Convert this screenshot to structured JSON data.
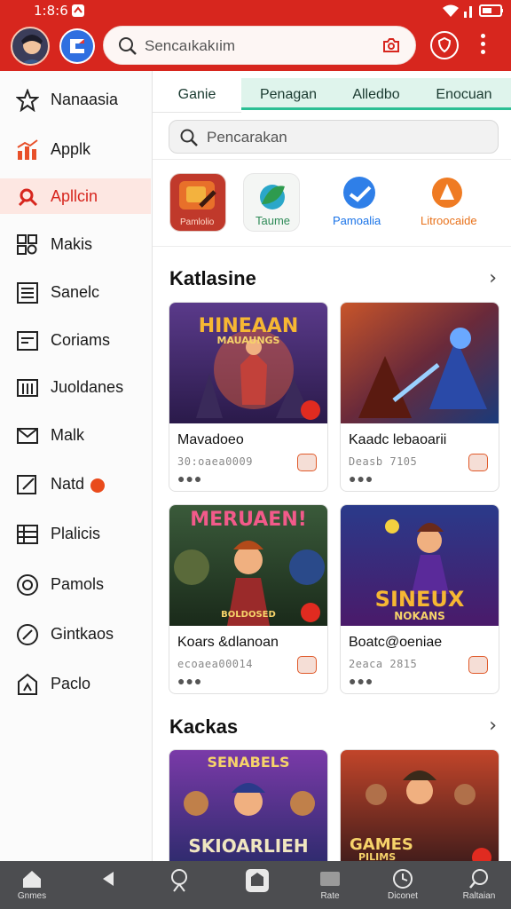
{
  "status_bar": {
    "time": "1:8:6 6"
  },
  "top_bar": {
    "search_placeholder": "Sencaıkakıim",
    "icons": [
      "avatar",
      "app-logo-icon",
      "search-icon",
      "camera-icon",
      "shield-icon",
      "more-vert-icon"
    ]
  },
  "sidebar": {
    "items": [
      {
        "label": "Nanaasia",
        "icon": "star-icon",
        "active": false
      },
      {
        "label": "Applk",
        "icon": "chart-icon",
        "active": false
      },
      {
        "label": "Apllcin",
        "icon": "rocket-icon",
        "active": true
      },
      {
        "label": "Makis",
        "icon": "grid-icon",
        "active": false
      },
      {
        "label": "Sanelc",
        "icon": "list-icon",
        "active": false
      },
      {
        "label": "Coriams",
        "icon": "monitor-icon",
        "active": false
      },
      {
        "label": "Juoldanes",
        "icon": "bars-icon",
        "active": false
      },
      {
        "label": "Malk",
        "icon": "mail-icon",
        "active": false
      },
      {
        "label": "Natd",
        "icon": "edit-icon",
        "active": false,
        "badge": true
      },
      {
        "label": "Plalicis",
        "icon": "table-icon",
        "active": false
      },
      {
        "label": "Pamols",
        "icon": "globe-icon",
        "active": false
      },
      {
        "label": "Gintkaos",
        "icon": "leaf-icon",
        "active": false
      },
      {
        "label": "Paclo",
        "icon": "bag-icon",
        "active": false
      }
    ]
  },
  "content": {
    "tabs": [
      "Ganie",
      "Penagan",
      "Alledbo",
      "Enocuan"
    ],
    "search_placeholder": "Pencarakan",
    "shortcuts": [
      {
        "label": "Pamlolio",
        "color": "#c0392b"
      },
      {
        "label": "Taume",
        "color": "#2e8b57"
      },
      {
        "label": "Pamoalia",
        "color": "#1a73e8"
      },
      {
        "label": "Litroocaide",
        "color": "#e8711a"
      }
    ],
    "section1": {
      "title": "Katlasine",
      "cards": [
        {
          "art_text": "HINEAAN",
          "art_sub": "MAUAUNGS",
          "title": "Mavadoeo",
          "sub": "30:oaea0009"
        },
        {
          "art_text": "",
          "art_sub": "",
          "title": "Kaadc lebaoarii",
          "sub": "Deasb 7105"
        },
        {
          "art_text": "MERUAEN!",
          "art_sub": "BOLDOSED",
          "title": "Koars &dlanoan",
          "sub": "ecoaea00014"
        },
        {
          "art_text": "SINEUX",
          "art_sub": "NOKANS",
          "title": "Boatc@oeniae",
          "sub": "2eaca 2815"
        }
      ]
    },
    "section2": {
      "title": "Kackas",
      "cards": [
        {
          "art_text": "SENABELS",
          "art_sub": "SKIOARLIEH"
        },
        {
          "art_text": "GAMES",
          "art_sub": "PILIMS"
        }
      ]
    }
  },
  "bottom_nav": [
    {
      "label": "Gnmes",
      "icon": "home-icon"
    },
    {
      "label": "",
      "icon": "back-icon"
    },
    {
      "label": "",
      "icon": "location-icon"
    },
    {
      "label": "",
      "icon": "cube-icon"
    },
    {
      "label": "Rate",
      "icon": "card-icon"
    },
    {
      "label": "Diconet",
      "icon": "clock-icon"
    },
    {
      "label": "Raltaian",
      "icon": "search-icon"
    }
  ],
  "colors": {
    "brand_red": "#d7261e",
    "tab_accent": "#2bbf94",
    "active_bg": "#fde7e2"
  }
}
